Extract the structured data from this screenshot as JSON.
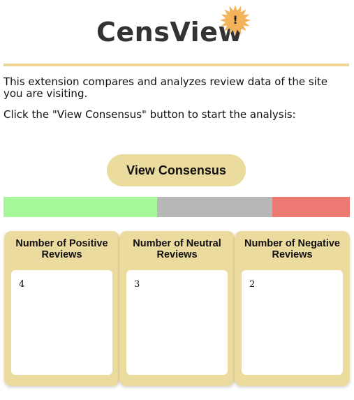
{
  "header": {
    "logo_text": "CensView",
    "logo_badge_glyph": "!",
    "logo_badge_icon": "starburst-icon"
  },
  "intro_text": "This extension compares and analyzes review data of the site you are visiting.",
  "instruction_text": "Click the \"View Consensus\" button to start the analysis:",
  "consensus_button_label": "View Consensus",
  "sentiment_bar": {
    "segments": [
      {
        "name": "positive",
        "fraction": 0.444,
        "color": "#a6f79a"
      },
      {
        "name": "neutral",
        "fraction": 0.333,
        "color": "#b7b7b7"
      },
      {
        "name": "negative",
        "fraction": 0.223,
        "color": "#ec7a72"
      }
    ]
  },
  "cards": [
    {
      "title": "Number of Positive Reviews",
      "count": "4"
    },
    {
      "title": "Number of Neutral Reviews",
      "count": "3"
    },
    {
      "title": "Number of Negative Reviews",
      "count": "2"
    }
  ],
  "colors": {
    "accent": "#ecdb9e",
    "divider": "#ecd796",
    "logo_burst": "#f3b35a"
  }
}
